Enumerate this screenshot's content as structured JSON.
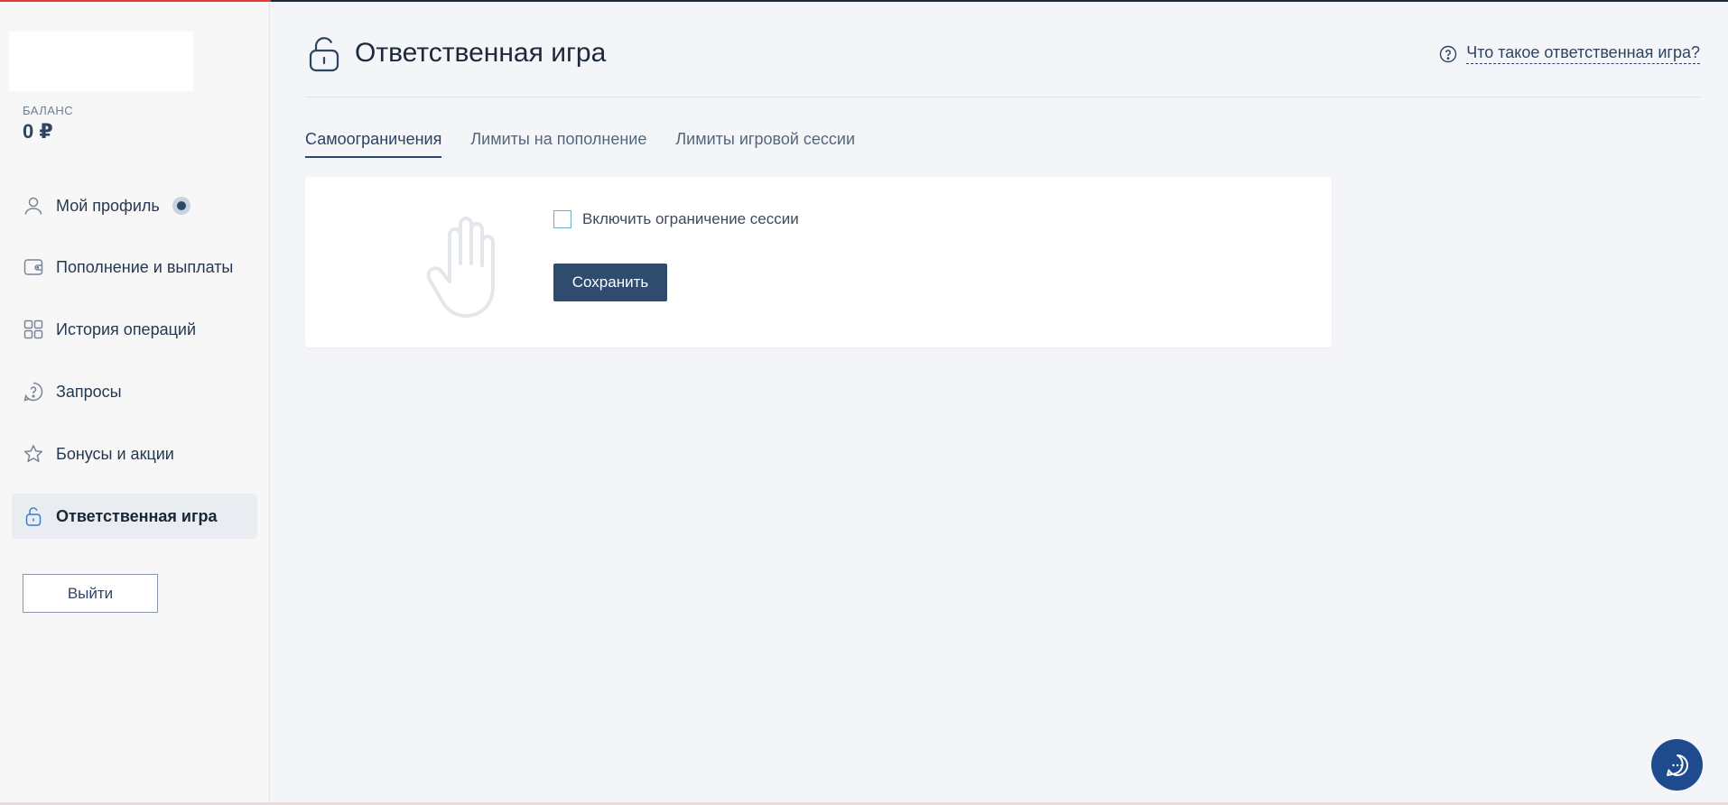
{
  "sidebar": {
    "balance_label": "БАЛАНС",
    "balance_value": "0 ₽",
    "items": [
      {
        "label": "Мой профиль",
        "icon": "user-icon"
      },
      {
        "label": "Пополнение и выплаты",
        "icon": "wallet-icon"
      },
      {
        "label": "История операций",
        "icon": "grid-icon"
      },
      {
        "label": "Запросы",
        "icon": "question-icon"
      },
      {
        "label": "Бонусы и акции",
        "icon": "star-icon"
      },
      {
        "label": "Ответственная игра",
        "icon": "lock-icon",
        "active": true
      }
    ],
    "logout_label": "Выйти"
  },
  "header": {
    "title": "Ответственная игра",
    "help_link": "Что такое ответственная игра?"
  },
  "tabs": [
    {
      "label": "Самоограничения",
      "active": true
    },
    {
      "label": "Лимиты на пополнение",
      "active": false
    },
    {
      "label": "Лимиты игровой сессии",
      "active": false
    }
  ],
  "card": {
    "checkbox_label": "Включить ограничение сессии",
    "checkbox_checked": false,
    "save_label": "Сохранить"
  },
  "colors": {
    "accent": "#2f4b6e",
    "chat": "#1e4a8e",
    "top_accent": "#e33a3a"
  }
}
